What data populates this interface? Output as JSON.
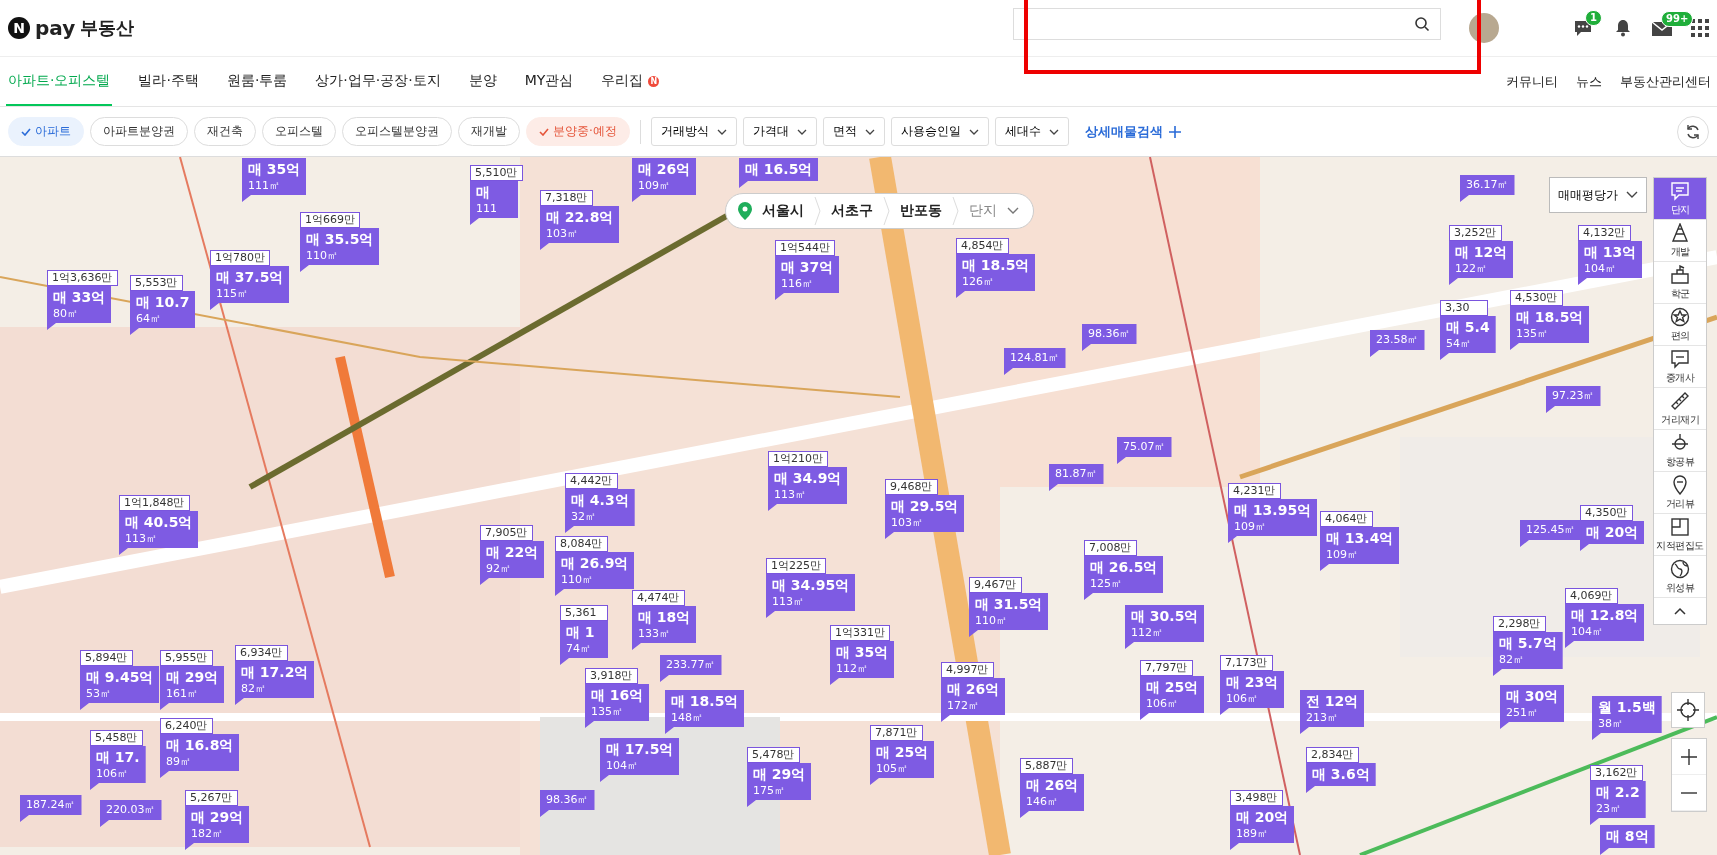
{
  "logo": {
    "badge": "N",
    "brand": "pay",
    "name": "부동산"
  },
  "header": {
    "chat_badge": "1",
    "mail_badge": "99+"
  },
  "nav": {
    "tabs": [
      {
        "label": "아파트·오피스텔",
        "selected": true
      },
      {
        "label": "빌라·주택",
        "selected": false
      },
      {
        "label": "원룸·투룸",
        "selected": false
      },
      {
        "label": "상가·업무·공장·토지",
        "selected": false
      },
      {
        "label": "분양",
        "selected": false
      },
      {
        "label": "MY관심",
        "selected": false
      },
      {
        "label": "우리집",
        "selected": false,
        "badge": "N"
      }
    ],
    "links": [
      "커뮤니티",
      "뉴스",
      "부동산관리센터"
    ]
  },
  "filters": {
    "chips": [
      {
        "label": "아파트",
        "selected": true
      },
      {
        "label": "아파트분양권",
        "selected": false
      },
      {
        "label": "재건축",
        "selected": false
      },
      {
        "label": "오피스텔",
        "selected": false
      },
      {
        "label": "오피스텔분양권",
        "selected": false
      },
      {
        "label": "재개발",
        "selected": false
      },
      {
        "label": "분양중·예정",
        "selected": true
      }
    ],
    "dropdowns": [
      "거래방식",
      "가격대",
      "면적",
      "사용승인일",
      "세대수"
    ],
    "detail_search": "상세매물검색"
  },
  "breadcrumb": {
    "items": [
      "서울시",
      "서초구",
      "반포동"
    ],
    "last": "단지"
  },
  "price_mode": "매매평당가",
  "toolbar": [
    {
      "label": "단지",
      "selected": true
    },
    {
      "label": "개발",
      "selected": false
    },
    {
      "label": "학군",
      "selected": false
    },
    {
      "label": "편의",
      "selected": false
    },
    {
      "label": "중개사",
      "selected": false
    },
    {
      "label": "거리재기",
      "selected": false
    },
    {
      "label": "항공뷰",
      "selected": false
    },
    {
      "label": "거리뷰",
      "selected": false
    },
    {
      "label": "지적편집도",
      "selected": false
    },
    {
      "label": "위성뷰",
      "selected": false
    }
  ],
  "markers": [
    {
      "kind": "full",
      "price": "1억3,636만",
      "deal": "매 33억",
      "area": "80㎡"
    },
    {
      "kind": "full",
      "price": "5,553만",
      "deal": "매 10.7",
      "area": "64㎡"
    },
    {
      "kind": "full",
      "price": "1억780만",
      "deal": "매 37.5억",
      "area": "115㎡"
    },
    {
      "kind": "full",
      "price": "1억669만",
      "deal": "매 35.5억",
      "area": "110㎡"
    },
    {
      "kind": "full",
      "deal": "매 35억",
      "area": "111㎡"
    },
    {
      "kind": "full",
      "price": "5,510만",
      "deal": "매",
      "area": "111"
    },
    {
      "kind": "full",
      "price": "7,318만",
      "deal": "매 22.8억",
      "area": "103㎡"
    },
    {
      "kind": "full",
      "deal": "매 26억",
      "area": "109㎡"
    },
    {
      "kind": "full",
      "deal": "매 16.5억"
    },
    {
      "kind": "full",
      "price": "1억544만",
      "deal": "매 37억",
      "area": "116㎡"
    },
    {
      "kind": "full",
      "price": "1억210만",
      "deal": "매 34.9억",
      "area": "113㎡"
    },
    {
      "kind": "full",
      "price": "4,442만",
      "deal": "매 4.3억",
      "area": "32㎡"
    },
    {
      "kind": "full",
      "price": "1억1,848만",
      "deal": "매 40.5억",
      "area": "113㎡"
    },
    {
      "kind": "full",
      "price": "7,905만",
      "deal": "매 22억",
      "area": "92㎡"
    },
    {
      "kind": "full",
      "price": "4,854만",
      "deal": "매 18.5억",
      "area": "126㎡"
    },
    {
      "kind": "area",
      "area": "124.81㎡"
    },
    {
      "kind": "area",
      "area": "98.36㎡"
    },
    {
      "kind": "area",
      "area": "75.07㎡"
    },
    {
      "kind": "area",
      "area": "81.87㎡"
    },
    {
      "kind": "full",
      "price": "9,468만",
      "deal": "매 29.5억",
      "area": "103㎡"
    },
    {
      "kind": "full",
      "price": "4,231만",
      "deal": "매 13.95억",
      "area": "109㎡"
    },
    {
      "kind": "full",
      "price": "4,064만",
      "deal": "매 13.4억",
      "area": "109㎡"
    },
    {
      "kind": "area",
      "area": "36.17㎡"
    },
    {
      "kind": "full",
      "price": "3,252만",
      "deal": "매 12억",
      "area": "122㎡"
    },
    {
      "kind": "area",
      "area": "23.58㎡"
    },
    {
      "kind": "full",
      "price": "3,30",
      "deal": "매 5.4",
      "area": "54㎡"
    },
    {
      "kind": "full",
      "price": "4,530만",
      "deal": "매 18.5억",
      "area": "135㎡"
    },
    {
      "kind": "full",
      "price": "4,132만",
      "deal": "매 13억",
      "area": "104㎡"
    },
    {
      "kind": "area",
      "area": "97.23㎡"
    },
    {
      "kind": "full",
      "price": "4,350만",
      "deal": "매 20억"
    },
    {
      "kind": "full",
      "price": "8,084만",
      "deal": "매 26.9억",
      "area": "110㎡"
    },
    {
      "kind": "full",
      "price": "5,361",
      "deal": "매 1",
      "area": "74㎡"
    },
    {
      "kind": "full",
      "price": "4,474만",
      "deal": "매 18억",
      "area": "133㎡"
    },
    {
      "kind": "full",
      "price": "1억225만",
      "deal": "매 34.95억",
      "area": "113㎡"
    },
    {
      "kind": "full",
      "price": "1억331만",
      "deal": "매 35억",
      "area": "112㎡"
    },
    {
      "kind": "full",
      "price": "5,894만",
      "deal": "매 9.45억",
      "area": "53㎡"
    },
    {
      "kind": "full",
      "price": "5,955만",
      "deal": "매 29억",
      "area": "161㎡"
    },
    {
      "kind": "full",
      "price": "6,934만",
      "deal": "매 17.2억",
      "area": "82㎡"
    },
    {
      "kind": "full",
      "price": "5,458만",
      "deal": "매 17.",
      "area": "106㎡"
    },
    {
      "kind": "full",
      "price": "6,240만",
      "deal": "매 16.8억",
      "area": "89㎡"
    },
    {
      "kind": "area",
      "area": "187.24㎡"
    },
    {
      "kind": "area",
      "area": "220.03㎡"
    },
    {
      "kind": "full",
      "price": "5,267만",
      "deal": "매 29억",
      "area": "182㎡"
    },
    {
      "kind": "area",
      "area": "233.77㎡"
    },
    {
      "kind": "full",
      "price": "3,918만",
      "deal": "매 16억",
      "area": "135㎡"
    },
    {
      "kind": "full",
      "deal": "매 18.5억",
      "area": "148㎡"
    },
    {
      "kind": "full",
      "deal": "매 17.5억",
      "area": "104㎡"
    },
    {
      "kind": "full",
      "price": "5,478만",
      "deal": "매 29억",
      "area": "175㎡"
    },
    {
      "kind": "area",
      "area": "98.36㎡"
    },
    {
      "kind": "full",
      "price": "7,008만",
      "deal": "매 26.5억",
      "area": "125㎡"
    },
    {
      "kind": "full",
      "price": "9,467만",
      "deal": "매 31.5억",
      "area": "110㎡"
    },
    {
      "kind": "full",
      "deal": "매 30.5억",
      "area": "112㎡"
    },
    {
      "kind": "full",
      "price": "4,997만",
      "deal": "매 26억",
      "area": "172㎡"
    },
    {
      "kind": "full",
      "price": "7,797만",
      "deal": "매 25억",
      "area": "106㎡"
    },
    {
      "kind": "full",
      "price": "7,173만",
      "deal": "매 23억",
      "area": "106㎡"
    },
    {
      "kind": "full",
      "deal": "전 12억",
      "area": "213㎡"
    },
    {
      "kind": "full",
      "price": "7,871만",
      "deal": "매 25억",
      "area": "105㎡"
    },
    {
      "kind": "full",
      "price": "5,887만",
      "deal": "매 26억",
      "area": "146㎡"
    },
    {
      "kind": "full",
      "price": "2,834만",
      "deal": "매 3.6억"
    },
    {
      "kind": "full",
      "price": "3,498만",
      "deal": "매 20억",
      "area": "189㎡"
    },
    {
      "kind": "area",
      "area": "125.45㎡"
    },
    {
      "kind": "full",
      "price": "4,069만",
      "deal": "매 12.8억",
      "area": "104㎡"
    },
    {
      "kind": "full",
      "price": "2,298만",
      "deal": "매 5.7억",
      "area": "82㎡"
    },
    {
      "kind": "full",
      "deal": "매 30억",
      "area": "251㎡"
    },
    {
      "kind": "full",
      "deal": "월 1.5백",
      "area": "38㎡"
    },
    {
      "kind": "full",
      "price": "3,162만",
      "deal": "매 2.2",
      "area": "23㎡"
    },
    {
      "kind": "full",
      "deal": "매 8억"
    }
  ]
}
